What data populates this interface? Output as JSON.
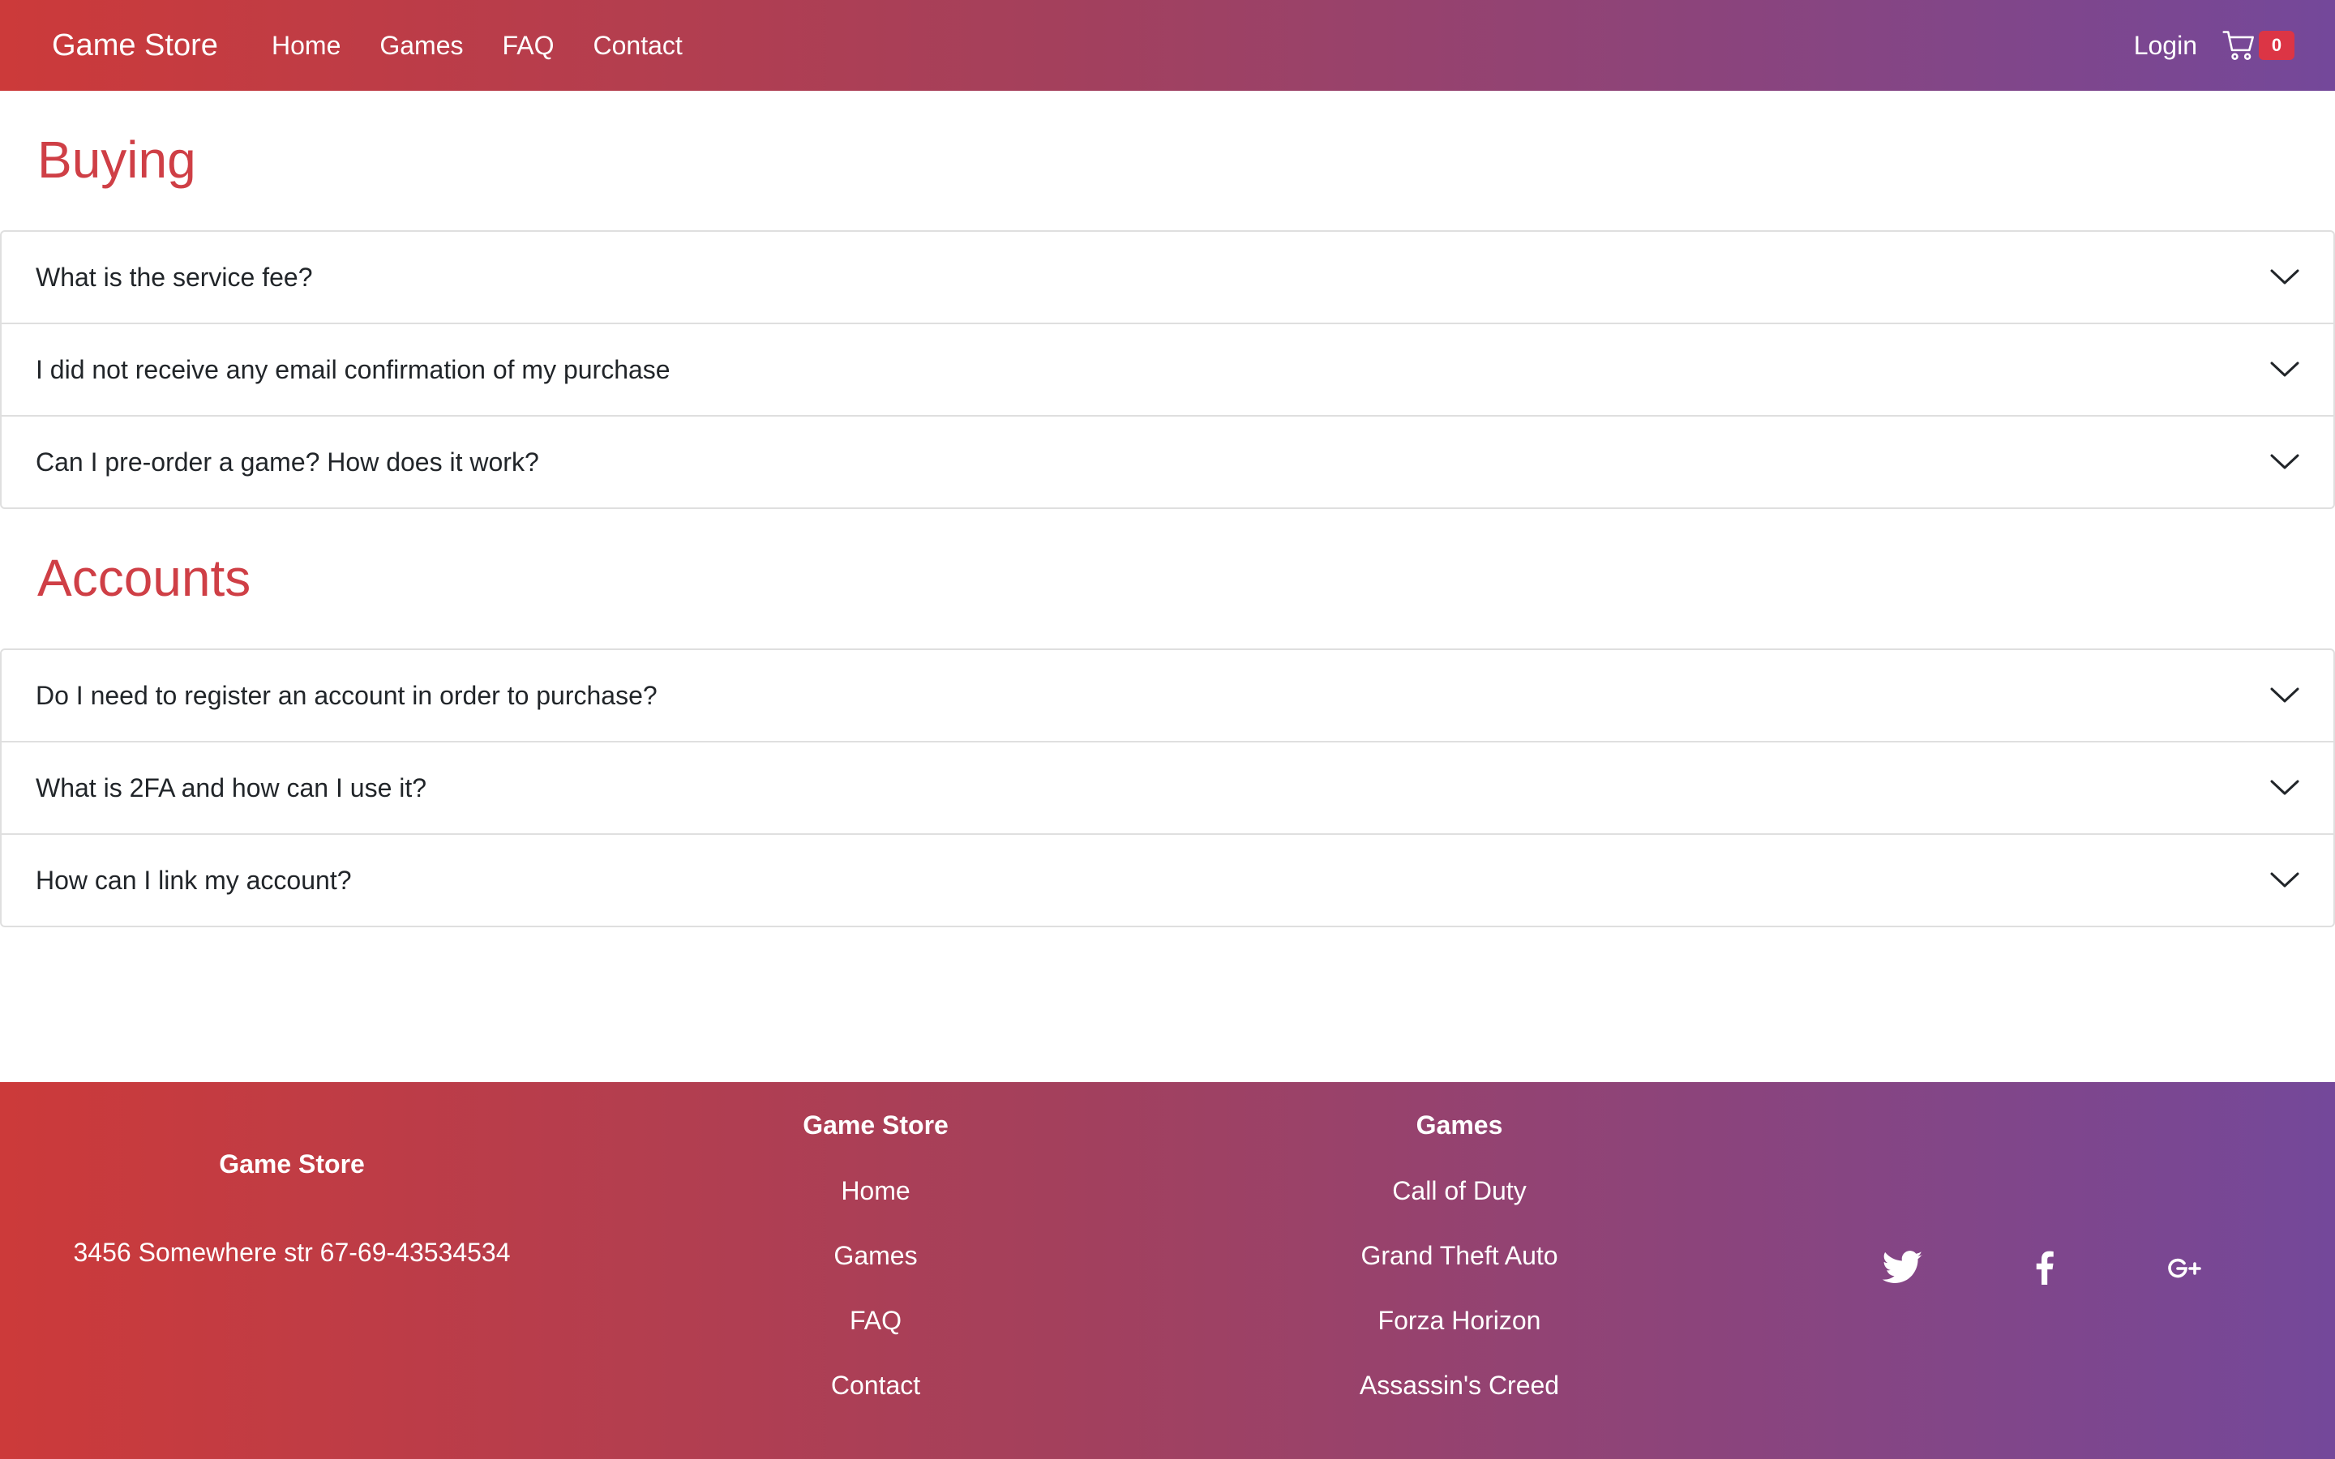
{
  "navbar": {
    "brand": "Game Store",
    "links": [
      "Home",
      "Games",
      "FAQ",
      "Contact"
    ],
    "login": "Login",
    "cart_count": "0"
  },
  "faq": {
    "sections": [
      {
        "title": "Buying",
        "questions": [
          "What is the service fee?",
          "I did not receive any email confirmation of my purchase",
          "Can I pre-order a game? How does it work?"
        ]
      },
      {
        "title": "Accounts",
        "questions": [
          "Do I need to register an account in order to purchase?",
          "What is 2FA and how can I use it?",
          "How can I link my account?"
        ]
      }
    ]
  },
  "footer": {
    "about": {
      "title": "Game Store",
      "address": "3456 Somewhere str 67-69-43534534"
    },
    "store_col": {
      "title": "Game Store",
      "links": [
        "Home",
        "Games",
        "FAQ",
        "Contact"
      ]
    },
    "games_col": {
      "title": "Games",
      "links": [
        "Call of Duty",
        "Grand Theft Auto",
        "Forza Horizon",
        "Assassin's Creed"
      ]
    },
    "social": [
      "twitter-icon",
      "facebook-icon",
      "google-plus-icon"
    ]
  },
  "colors": {
    "gradient_start": "#cc3a3a",
    "gradient_end": "#74489a",
    "section_title": "#cf3f46",
    "badge": "#dc3545"
  }
}
